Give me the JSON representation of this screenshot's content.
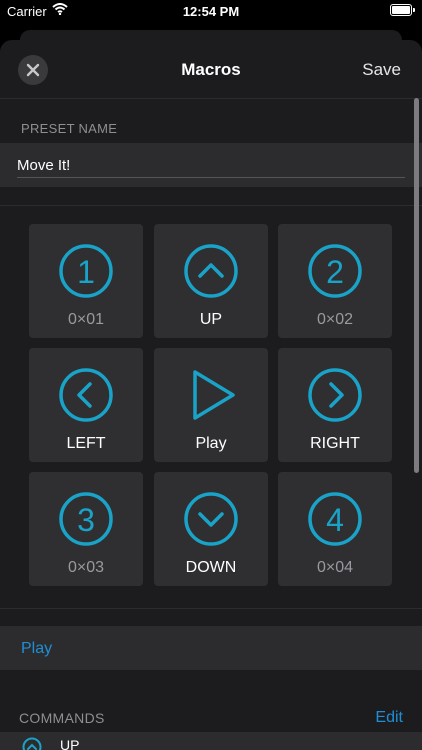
{
  "status_bar": {
    "carrier": "Carrier",
    "time": "12:54 PM"
  },
  "navbar": {
    "title": "Macros",
    "save_label": "Save"
  },
  "preset": {
    "section_label": "PRESET NAME",
    "name_value": "Move It!"
  },
  "pads": [
    {
      "name": "pad-preset-1",
      "icon": "number-1-icon",
      "label": "0×01",
      "style": "code"
    },
    {
      "name": "pad-up",
      "icon": "chevron-up-icon",
      "label": "UP",
      "style": "action"
    },
    {
      "name": "pad-preset-2",
      "icon": "number-2-icon",
      "label": "0×02",
      "style": "code"
    },
    {
      "name": "pad-left",
      "icon": "chevron-left-icon",
      "label": "LEFT",
      "style": "action"
    },
    {
      "name": "pad-play",
      "icon": "play-icon",
      "label": "Play",
      "style": "action"
    },
    {
      "name": "pad-right",
      "icon": "chevron-right-icon",
      "label": "RIGHT",
      "style": "action"
    },
    {
      "name": "pad-preset-3",
      "icon": "number-3-icon",
      "label": "0×03",
      "style": "code"
    },
    {
      "name": "pad-down",
      "icon": "chevron-down-icon",
      "label": "DOWN",
      "style": "action"
    },
    {
      "name": "pad-preset-4",
      "icon": "number-4-icon",
      "label": "0×04",
      "style": "code"
    }
  ],
  "play_row": {
    "label": "Play"
  },
  "commands": {
    "section_label": "COMMANDS",
    "edit_label": "Edit",
    "items": [
      {
        "label": "UP",
        "icon": "chevron-up-icon"
      }
    ]
  },
  "colors": {
    "accent": "#1e8fd6",
    "icon_cyan": "#1aa3c8",
    "background": "#1c1c1e",
    "pad": "#2f2f32"
  }
}
